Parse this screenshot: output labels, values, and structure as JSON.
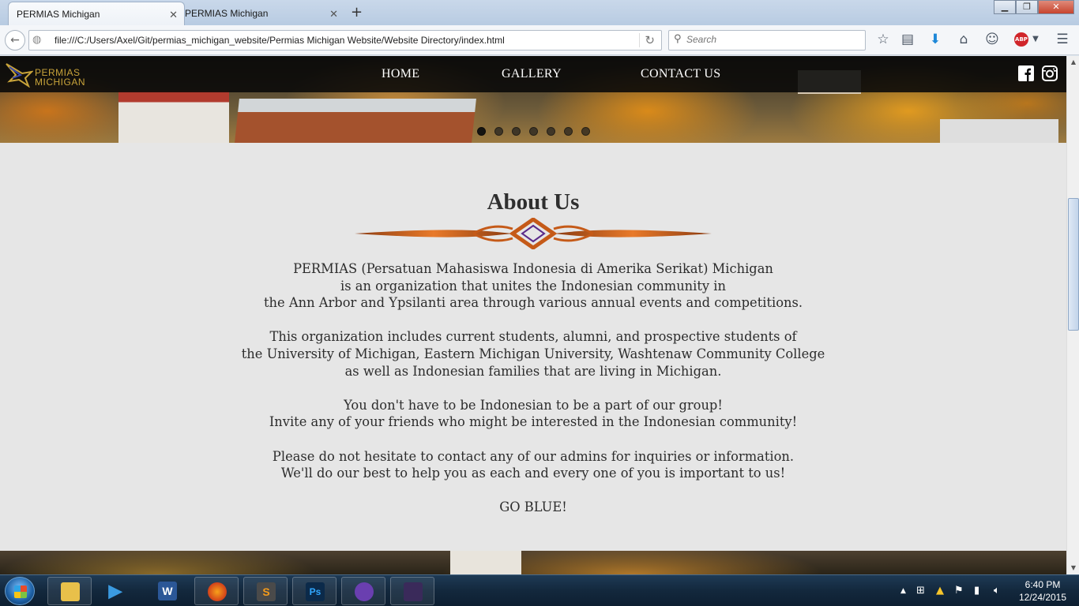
{
  "browser": {
    "tabs": [
      {
        "title": "PERMIAS Michigan",
        "active": true
      },
      {
        "title": "PERMIAS Michigan",
        "active": false
      }
    ],
    "new_tab_symbol": "+",
    "url": "file:///C:/Users/Axel/Git/permias_michigan_website/Permias Michigan Website/Website Directory/index.html",
    "search_placeholder": "Search",
    "abp_badge": "ABP",
    "toolbar_icons": [
      "back-icon",
      "globe-icon",
      "reload-icon",
      "search-icon",
      "bookmark-star-icon",
      "reading-list-icon",
      "download-icon",
      "home-icon",
      "chat-icon",
      "adblock-icon",
      "menu-icon"
    ]
  },
  "site": {
    "logo": {
      "line1": "PERMIAS",
      "line2": "MICHIGAN"
    },
    "nav": [
      {
        "label": "HOME"
      },
      {
        "label": "GALLERY"
      },
      {
        "label": "CONTACT US"
      }
    ],
    "social_icons": [
      "facebook-icon",
      "instagram-icon"
    ],
    "carousel": {
      "slide_count": 7,
      "active_index": 0
    },
    "about": {
      "title": "About Us",
      "paragraphs": [
        [
          "PERMIAS (Persatuan Mahasiswa Indonesia di Amerika Serikat) Michigan",
          "is an organization that unites the Indonesian community in",
          "the Ann Arbor and Ypsilanti area through various annual events and competitions."
        ],
        [
          "This organization includes current students, alumni, and prospective students of",
          "the University of Michigan, Eastern Michigan University, Washtenaw Community College",
          "as well as Indonesian families that are living in Michigan."
        ],
        [
          "You don't have to be Indonesian to be a part of our group!",
          "Invite any of your friends who might be interested in the Indonesian community!"
        ],
        [
          "Please do not hesitate to contact any of our admins for inquiries or information.",
          "We'll do our best to help you as each and every one of you is important to us!"
        ],
        [
          "GO BLUE!"
        ]
      ]
    }
  },
  "taskbar": {
    "apps": [
      "windows-explorer",
      "media-player",
      "word",
      "firefox",
      "sublime-text",
      "photoshop",
      "purple-cat-app",
      "app-thumbnail"
    ],
    "app_letters": {
      "word": "W",
      "sublime": "S",
      "photoshop": "Ps"
    },
    "clock_time": "6:40 PM",
    "clock_date": "12/24/2015"
  },
  "colors": {
    "accent_gold": "#c9a43a",
    "nav_bg": "#0a0a0a",
    "page_bg": "#e6e6e6",
    "ornament": "#d2691e"
  }
}
